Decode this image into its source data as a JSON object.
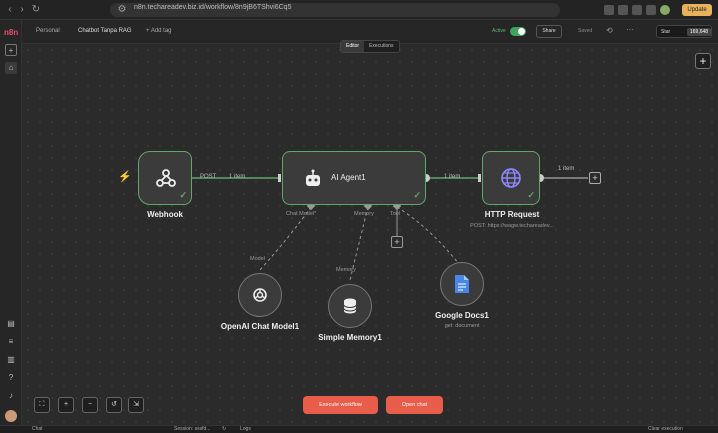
{
  "browser": {
    "url": "n8n.techareadev.biz.id/workflow/8n9jB6TShvi6Cq5",
    "update_label": "Update"
  },
  "header": {
    "breadcrumb_owner": "Personal",
    "workflow_name": "Chatbot Tanpa RAG",
    "add_tag": "+ Add tag",
    "active_label": "Active",
    "share_label": "Share",
    "saved_label": "Saved",
    "star_label": "Star",
    "star_count": "169,648"
  },
  "tabs": [
    {
      "label": "Editor",
      "active": true
    },
    {
      "label": "Executions",
      "active": false
    }
  ],
  "nodes": {
    "webhook": {
      "label": "Webhook",
      "icon": "webhook-icon"
    },
    "agent": {
      "label": "AI Agent1",
      "icon": "robot-icon"
    },
    "http": {
      "label": "HTTP Request",
      "subtitle": "POST: https://wagw.techareadev...",
      "icon": "globe-icon"
    },
    "openai": {
      "label": "OpenAI Chat Model1",
      "icon": "openai-icon"
    },
    "memory": {
      "label": "Simple Memory1",
      "icon": "database-icon"
    },
    "docs": {
      "label": "Google Docs1",
      "subtitle": "get: document",
      "icon": "docs-icon"
    }
  },
  "edges": {
    "webhook_post": "POST",
    "webhook_items": "1 item",
    "agent_items": "1 item",
    "http_items": "1 item"
  },
  "ports": {
    "chat_model": "Chat Model*",
    "memory": "Memory",
    "tool": "Tool",
    "model": "Model",
    "memory_in": "Memory"
  },
  "actions": {
    "execute": "Execute workflow",
    "open_chat": "Open chat"
  },
  "bottom": {
    "chat": "Chat",
    "session": "Session: sssfd...",
    "logs": "Logs",
    "clear": "Clear execution"
  },
  "colors": {
    "accent": "#ea4b71",
    "success": "#5fa869",
    "execute": "#e85d4a"
  }
}
